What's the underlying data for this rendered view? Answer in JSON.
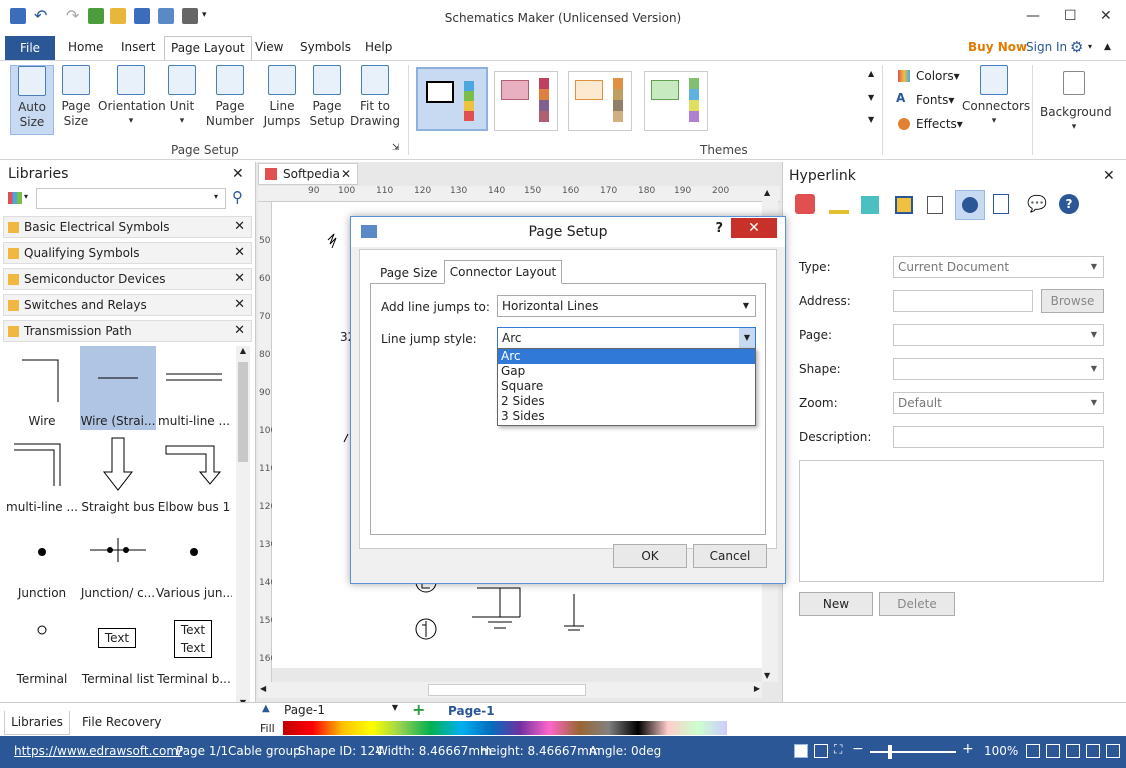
{
  "window": {
    "title": "Schematics Maker (Unlicensed Version)"
  },
  "menu": {
    "file": "File",
    "items": [
      "Home",
      "Insert",
      "Page Layout",
      "View",
      "Symbols",
      "Help"
    ],
    "buy_now": "Buy Now",
    "sign_in": "Sign In"
  },
  "ribbon": {
    "buttons": [
      {
        "line1": "Auto",
        "line2": "Size"
      },
      {
        "line1": "Page",
        "line2": "Size"
      },
      {
        "line1": "Orientation",
        "line2": ""
      },
      {
        "line1": "Unit",
        "line2": ""
      },
      {
        "line1": "Page",
        "line2": "Number"
      },
      {
        "line1": "Line",
        "line2": "Jumps"
      },
      {
        "line1": "Page",
        "line2": "Setup"
      },
      {
        "line1": "Fit to",
        "line2": "Drawing"
      }
    ],
    "group_page_setup": "Page Setup",
    "group_themes": "Themes",
    "colors": "Colors",
    "fonts": "Fonts",
    "effects": "Effects",
    "connectors": "Connectors",
    "background": "Background"
  },
  "libraries": {
    "title": "Libraries",
    "search_placeholder": "",
    "categories": [
      "Basic Electrical Symbols",
      "Qualifying Symbols",
      "Semiconductor Devices",
      "Switches and Relays",
      "Transmission Path"
    ],
    "shapes": [
      "Wire",
      "Wire (Strai...",
      "multi-line ...",
      "multi-line ...",
      "Straight bus",
      "Elbow bus 1",
      "Junction",
      "Junction/ c...",
      "Various jun...",
      "Terminal",
      "Terminal list",
      "Terminal b..."
    ],
    "text_label": "Text",
    "bottom_tabs": [
      "Libraries",
      "File Recovery"
    ]
  },
  "document": {
    "tab": "Softpedia",
    "page_tab": "Page-1",
    "page_tab_active": "Page-1",
    "ruler_h": [
      "90",
      "100",
      "110",
      "120",
      "130",
      "140",
      "150",
      "160",
      "170",
      "180",
      "190",
      "200"
    ],
    "ruler_v": [
      "50",
      "60",
      "70",
      "80",
      "90",
      "100",
      "110",
      "120",
      "130",
      "140",
      "150",
      "160"
    ],
    "canvas_text": "32",
    "fill_label": "Fill"
  },
  "dialog": {
    "title": "Page Setup",
    "help": "?",
    "tabs": [
      "Page Size",
      "Connector Layout"
    ],
    "add_jumps_label": "Add line jumps to:",
    "add_jumps_value": "Horizontal Lines",
    "style_label": "Line jump style:",
    "style_value": "Arc",
    "options": [
      "Arc",
      "Gap",
      "Square",
      "2 Sides",
      "3 Sides"
    ],
    "ok": "OK",
    "cancel": "Cancel"
  },
  "hyperlink": {
    "title": "Hyperlink",
    "type_label": "Type:",
    "type_value": "Current Document",
    "address_label": "Address:",
    "browse": "Browse",
    "page_label": "Page:",
    "shape_label": "Shape:",
    "zoom_label": "Zoom:",
    "zoom_value": "Default",
    "description_label": "Description:",
    "new": "New",
    "delete": "Delete"
  },
  "status": {
    "url": "https://www.edrawsoft.com/",
    "page": "Page 1/1",
    "group": "Cable group",
    "shape_id": "Shape ID: 124",
    "width": "Width: 8.46667mm",
    "height": "Height: 8.46667mm",
    "angle": "Angle: 0deg",
    "zoom": "100%"
  },
  "colors": {
    "accent": "#2b5797",
    "buy_now": "#e07b00",
    "selection": "#3079d6"
  }
}
